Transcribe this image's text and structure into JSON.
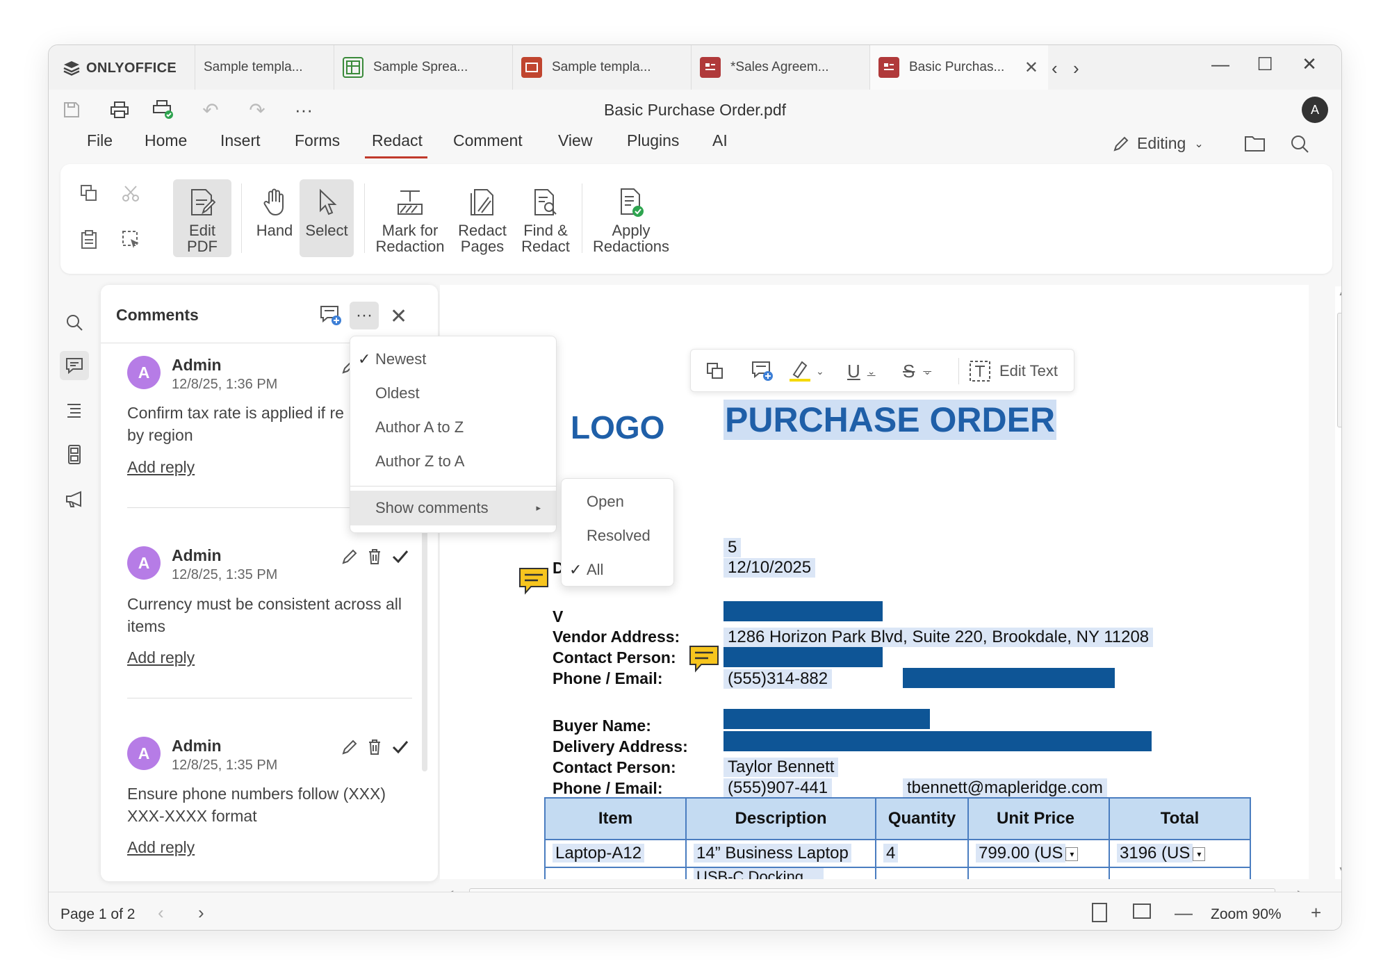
{
  "app": {
    "brand": "ONLYOFFICE",
    "doc_title": "Basic Purchase Order.pdf",
    "user_initial": "A"
  },
  "tabs": [
    {
      "label": "Sample templa...",
      "type": "doc"
    },
    {
      "label": "Sample Sprea...",
      "type": "sheet",
      "color": "#3a8a3a"
    },
    {
      "label": "Sample templa...",
      "type": "slide",
      "color": "#c0452f"
    },
    {
      "label": "*Sales Agreem...",
      "type": "pdf",
      "color": "#b0393a"
    },
    {
      "label": "Basic Purchas...",
      "type": "pdf",
      "color": "#b0393a",
      "active": true
    }
  ],
  "menu": [
    "File",
    "Home",
    "Insert",
    "Forms",
    "Redact",
    "Comment",
    "View",
    "Plugins",
    "AI"
  ],
  "menu_active": "Redact",
  "editing_label": "Editing",
  "ribbon": {
    "edit_pdf": "Edit PDF",
    "hand": "Hand",
    "select": "Select",
    "mark_for_redaction": "Mark for Redaction",
    "redact_pages": "Redact Pages",
    "find_redact": "Find & Redact",
    "apply_redactions": "Apply Redactions"
  },
  "comments_panel": {
    "title": "Comments",
    "items": [
      {
        "avatar": "A",
        "author": "Admin",
        "date": "12/8/25, 1:36 PM",
        "text": "Confirm tax rate is applied if re by region",
        "reply": "Add reply"
      },
      {
        "avatar": "A",
        "author": "Admin",
        "date": "12/8/25, 1:35 PM",
        "text": "Currency must be consistent across all items",
        "reply": "Add reply"
      },
      {
        "avatar": "A",
        "author": "Admin",
        "date": "12/8/25, 1:35 PM",
        "text": "Ensure phone numbers follow (XXX) XXX-XXXX format",
        "reply": "Add reply"
      }
    ]
  },
  "sort_menu": {
    "items": [
      {
        "label": "Newest",
        "checked": true
      },
      {
        "label": "Oldest",
        "checked": false
      },
      {
        "label": "Author A to Z",
        "checked": false
      },
      {
        "label": "Author Z to A",
        "checked": false
      }
    ],
    "show_comments": "Show comments"
  },
  "show_submenu": [
    {
      "label": "Open",
      "checked": false
    },
    {
      "label": "Resolved",
      "checked": false
    },
    {
      "label": "All",
      "checked": true
    }
  ],
  "floating_toolbar": {
    "edit_text": "Edit Text"
  },
  "document": {
    "logo": "LOGO",
    "title": "PURCHASE ORDER",
    "po_number": "5",
    "date": "12/10/2025",
    "labels": {
      "vendor_address": "Vendor Address:",
      "contact_person": "Contact Person:",
      "phone_email": "Phone / Email:",
      "buyer_name": "Buyer Name:",
      "delivery_address": "Delivery Address:",
      "contact_person_2": "Contact Person:",
      "phone_email_2": "Phone / Email:",
      "partial_w": "V",
      "partial_d": "D"
    },
    "vendor_address": "1286 Horizon Park Blvd, Suite 220, Brookdale, NY 11208",
    "vendor_phone": "(555)314-882",
    "buyer_contact": "Taylor Bennett",
    "buyer_phone": "(555)907-441",
    "buyer_email": "tbennett@mapleridge.com",
    "table": {
      "headers": [
        "Item",
        "Description",
        "Quantity",
        "Unit Price",
        "Total"
      ],
      "rows": [
        [
          "Laptop-A12",
          "14” Business Laptop",
          "4",
          "799.00 (US",
          "3196 (US"
        ],
        [
          "",
          "USB-C Docking ...",
          "",
          "",
          ""
        ]
      ]
    }
  },
  "status": {
    "page": "Page 1 of 2",
    "zoom": "Zoom 90%"
  }
}
